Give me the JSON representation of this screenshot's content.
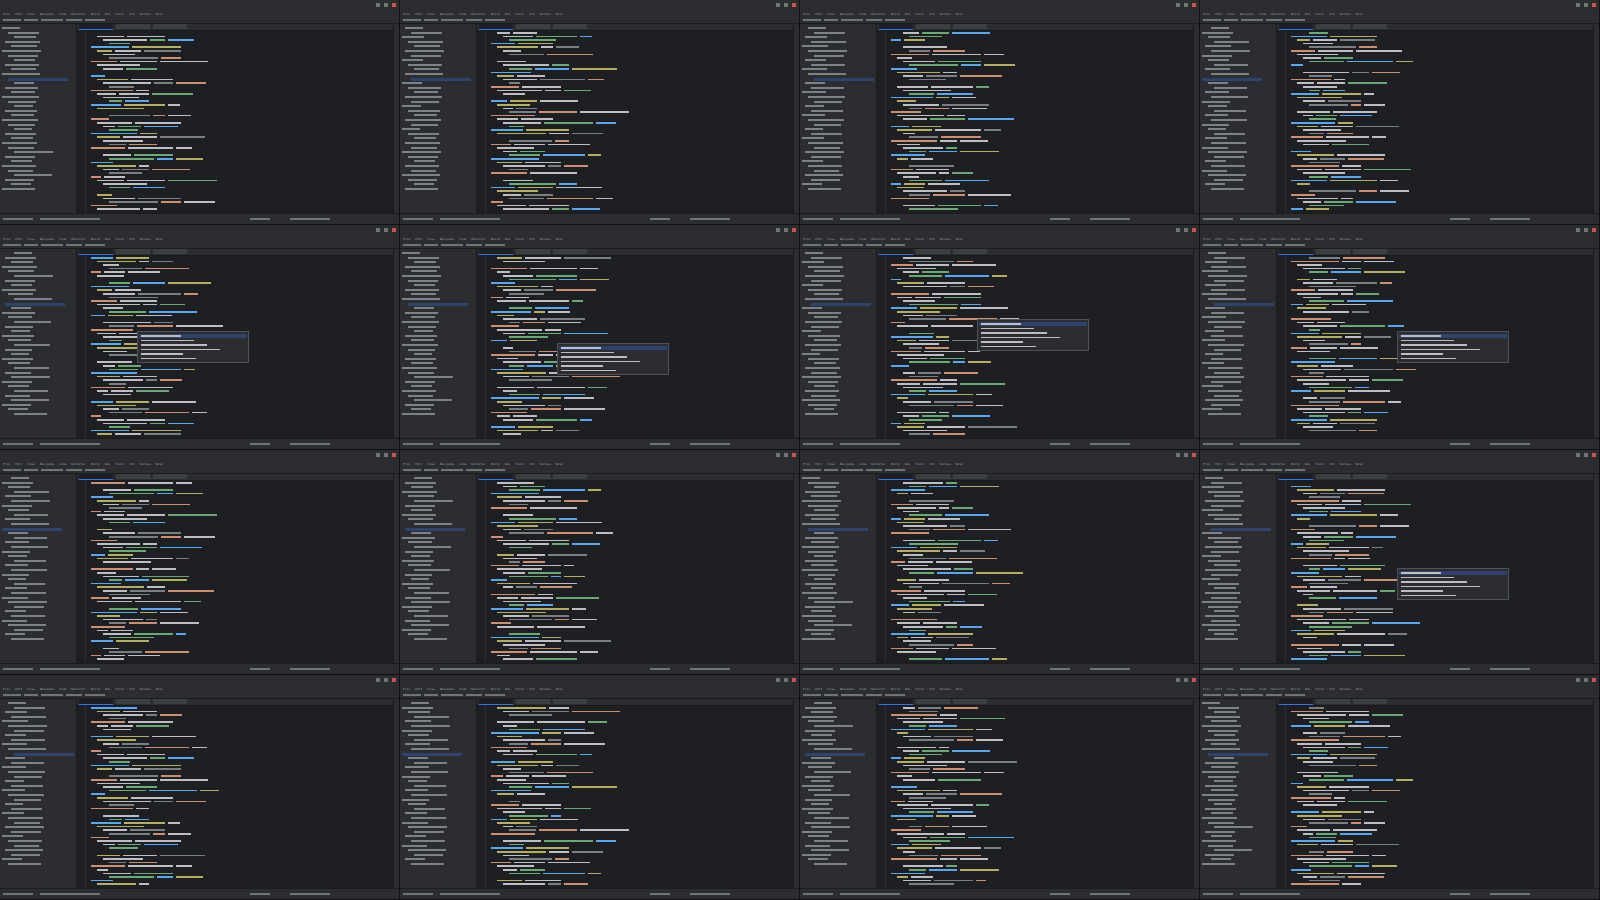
{
  "screen": {
    "layout": "4x4 grid of IDE screenshots",
    "ide_theme": "dark",
    "colors": {
      "background": "#1e1f22",
      "panel": "#2b2d30",
      "keyword": "#cf8e6d",
      "string": "#6aab73",
      "annotation": "#b3ae60",
      "identifier": "#bcbec4",
      "function": "#56a8f5",
      "selection": "#2e436e",
      "accent": "#3574f0",
      "close_button": "#c75450"
    },
    "icons": [
      "close-icon",
      "minimize-icon",
      "maximize-icon",
      "folder-icon"
    ],
    "menu_items": [
      "File",
      "Edit",
      "View",
      "Navigate",
      "Code",
      "Refactor",
      "Build",
      "Run",
      "Tools",
      "VCS",
      "Window",
      "Help"
    ],
    "frames": [
      {
        "popup": null
      },
      {
        "popup": null
      },
      {
        "popup": null
      },
      {
        "popup": null
      },
      {
        "popup": "completion"
      },
      {
        "popup": "completion"
      },
      {
        "popup": "completion"
      },
      {
        "popup": "completion"
      },
      {
        "popup": null
      },
      {
        "popup": null
      },
      {
        "popup": null
      },
      {
        "popup": "completion"
      },
      {
        "popup": null
      },
      {
        "popup": null
      },
      {
        "popup": null
      },
      {
        "popup": null
      }
    ]
  }
}
